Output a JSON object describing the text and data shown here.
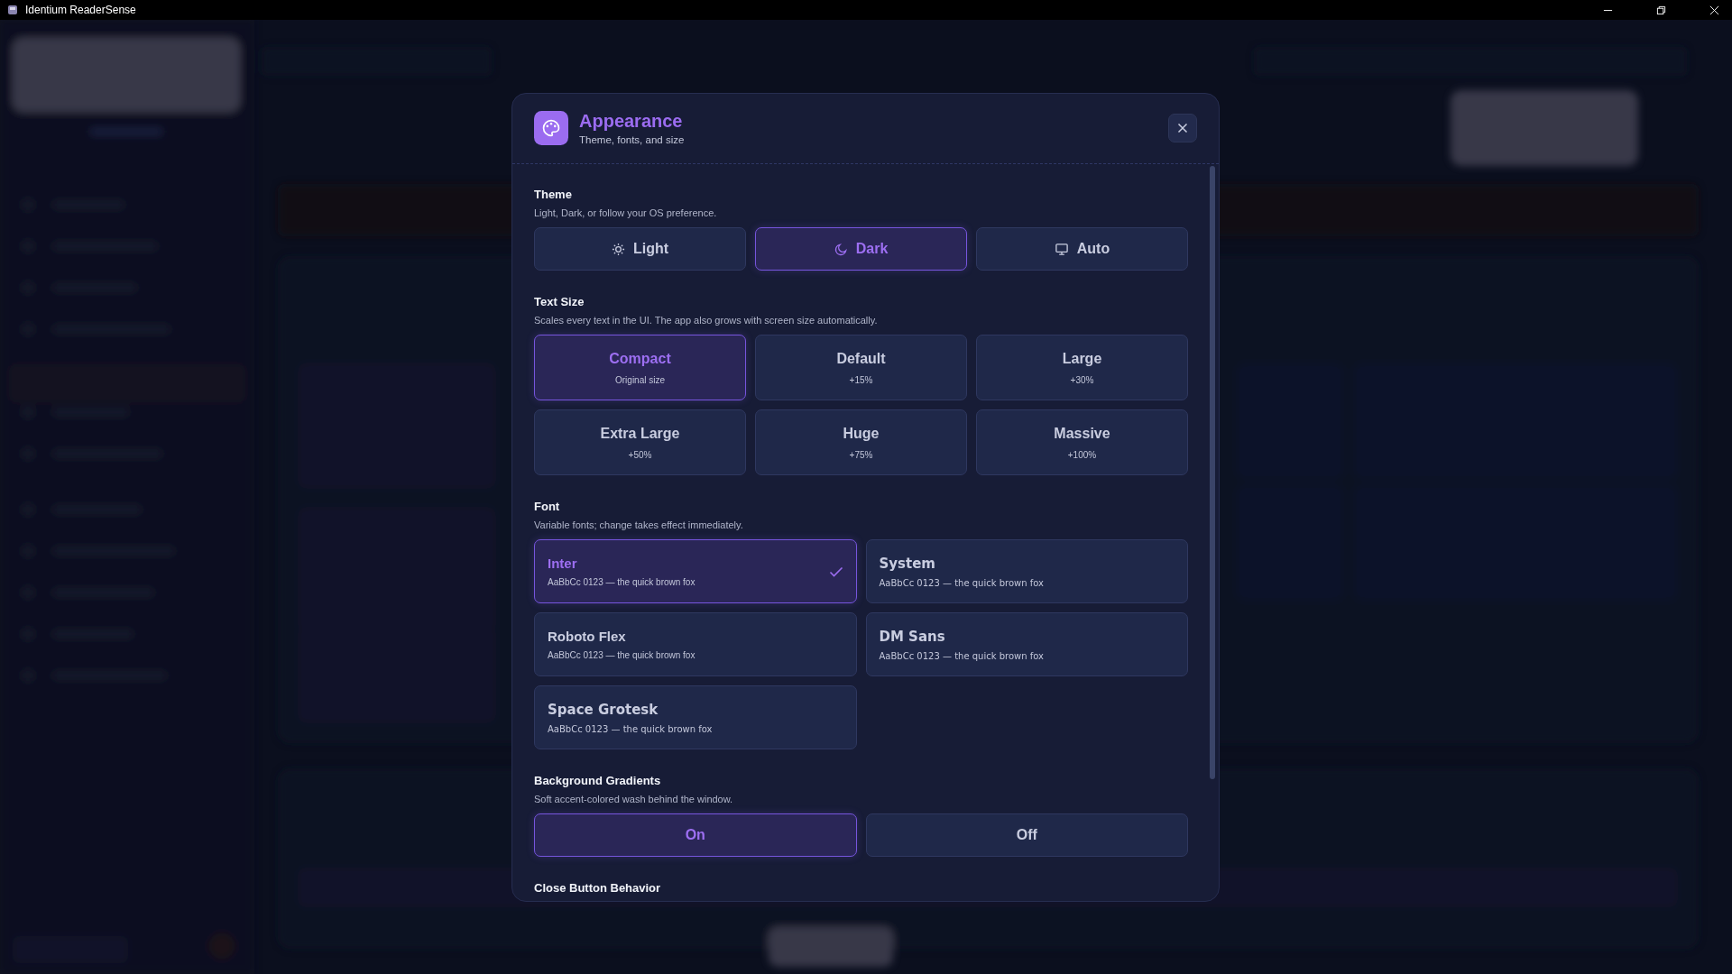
{
  "window": {
    "title": "Identium ReaderSense"
  },
  "dialog": {
    "title": "Appearance",
    "subtitle": "Theme, fonts, and size",
    "sections": [
      {
        "kind": "icon_choices",
        "title": "Theme",
        "description": "Light, Dark, or follow your OS preference.",
        "options": [
          {
            "label": "Light",
            "kind": "sun",
            "selected": false
          },
          {
            "label": "Dark",
            "kind": "moon",
            "selected": true
          },
          {
            "label": "Auto",
            "kind": "monitor",
            "selected": false
          }
        ]
      },
      {
        "kind": "size_choices",
        "title": "Text Size",
        "description": "Scales every text in the UI. The app also grows with screen size automatically.",
        "options": [
          {
            "label": "Compact",
            "note": "Original size",
            "selected": true
          },
          {
            "label": "Default",
            "note": "+15%",
            "selected": false
          },
          {
            "label": "Large",
            "note": "+30%",
            "selected": false
          },
          {
            "label": "Extra Large",
            "note": "+50%",
            "selected": false
          },
          {
            "label": "Huge",
            "note": "+75%",
            "selected": false
          },
          {
            "label": "Massive",
            "note": "+100%",
            "selected": false
          }
        ]
      },
      {
        "kind": "font_choices",
        "title": "Font",
        "description": "Variable fonts; change takes effect immediately.",
        "options": [
          {
            "label": "Inter",
            "sample": "AaBbCc 0123 — the quick brown fox",
            "selected": true
          },
          {
            "label": "System",
            "sample": "AaBbCc 0123 — the quick brown fox",
            "selected": false
          },
          {
            "label": "Roboto Flex",
            "sample": "AaBbCc 0123 — the quick brown fox",
            "selected": false
          },
          {
            "label": "DM Sans",
            "sample": "AaBbCc 0123 — the quick brown fox",
            "selected": false
          },
          {
            "label": "Space Grotesk",
            "sample": "AaBbCc 0123 — the quick brown fox",
            "selected": false
          }
        ]
      },
      {
        "kind": "toggle_choices",
        "title": "Background Gradients",
        "description": "Soft accent-colored wash behind the window.",
        "options": [
          {
            "label": "On",
            "selected": true
          },
          {
            "label": "Off",
            "selected": false
          }
        ]
      },
      {
        "kind": "heading_only",
        "title": "Close Button Behavior"
      }
    ]
  }
}
